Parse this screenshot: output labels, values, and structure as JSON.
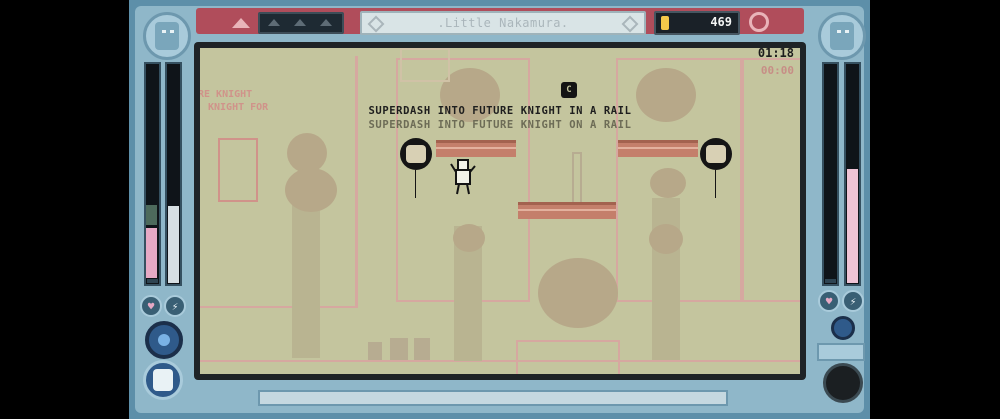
{
  "hud": {
    "level_title": ".Little Nakamura.",
    "coins": "469",
    "timer": "01:18",
    "best_time": "00:00"
  },
  "messages": {
    "line1": "SUPERDASH INTO FUTURE KNIGHT IN A RAIL",
    "line2": "SUPERDASH INTO FUTURE KNIGHT ON A RAIL",
    "faded_left_1": "RE KNIGHT",
    "faded_left_2": "KNIGHT FOR",
    "button_prompt": "C"
  },
  "meters": {
    "left_inner_level": 0.35,
    "left_outer_level": 0.0,
    "right_inner_level": 0.52,
    "right_outer_level": 0.0
  },
  "colors": {
    "frame": "#5d8fa9",
    "screen_bg": "#c4c59e",
    "accent_red": "#b04d5b",
    "pink_fill": "#e6a9c5",
    "coin": "#f4c94a"
  },
  "icons": {
    "heart": "♥",
    "bolt": "⚡"
  }
}
